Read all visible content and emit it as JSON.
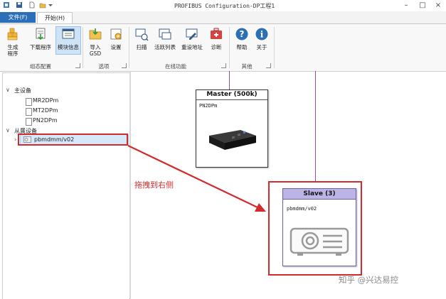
{
  "window": {
    "title": "PROFIBUS Configuration-DP工程1",
    "quick_access_icons": [
      "app-icon",
      "save-icon",
      "new-icon",
      "open-icon",
      "dropdown-icon"
    ],
    "controls": [
      "minimize-icon",
      "maximize-icon",
      "close-icon"
    ]
  },
  "tabs": {
    "file": "文件(F)",
    "start": "开始(H)"
  },
  "ribbon": {
    "groups": [
      {
        "label": "组态配置",
        "buttons": [
          {
            "label": "生成\n程序",
            "icon": "generate-program-icon"
          },
          {
            "label": "下载程序",
            "icon": "download-program-icon"
          },
          {
            "label": "模块信息",
            "icon": "module-info-icon",
            "active": true
          }
        ]
      },
      {
        "label": "选项",
        "buttons": [
          {
            "label": "导入\nGSD",
            "icon": "import-gsd-icon"
          },
          {
            "label": "设置",
            "icon": "settings-icon"
          }
        ]
      },
      {
        "label": "在线功能",
        "buttons": [
          {
            "label": "扫描",
            "icon": "scan-icon"
          },
          {
            "label": "活跃列表",
            "icon": "active-list-icon"
          },
          {
            "label": "重设地址",
            "icon": "reset-address-icon"
          },
          {
            "label": "诊断",
            "icon": "diagnose-icon"
          }
        ]
      },
      {
        "label": "其他",
        "buttons": [
          {
            "label": "帮助",
            "icon": "help-icon"
          },
          {
            "label": "关于",
            "icon": "about-icon"
          }
        ]
      }
    ]
  },
  "tree": {
    "master_group": "主设备",
    "masters": [
      "MR2DPm",
      "MT2DPm",
      "PN2DPm"
    ],
    "slave_group": "从属设备",
    "slaves": [
      "pbmdmm/v02"
    ]
  },
  "canvas": {
    "master": {
      "header": "Master (500k)",
      "name": "PN2DPm"
    },
    "slave": {
      "header": "Slave (3)",
      "name": "pbmdmm/v02"
    },
    "annotation": "拖拽到右侧",
    "watermark": "知乎 @兴达易控"
  },
  "colors": {
    "file_tab": "#2b6fb8",
    "selection": "#d6e8fb",
    "highlight_red": "#d32b2b",
    "bus_line": "#8a4fa0",
    "slave_header": "#bcb4e6"
  }
}
